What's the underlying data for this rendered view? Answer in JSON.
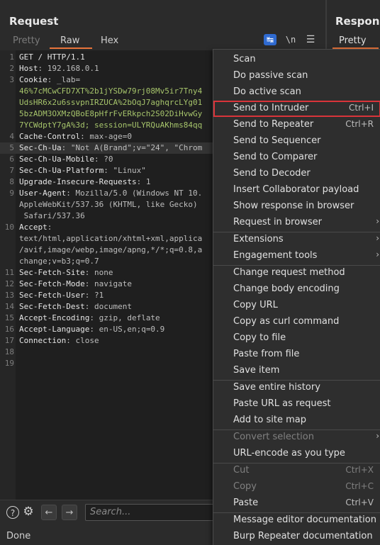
{
  "request_panel": {
    "title": "Request",
    "tabs": [
      {
        "label": "Pretty"
      },
      {
        "label": "Raw"
      },
      {
        "label": "Hex"
      }
    ],
    "toolbar": {
      "newline_label": "\\n"
    }
  },
  "response_panel": {
    "title": "Response",
    "tab": "Pretty"
  },
  "editor": {
    "lines": [
      {
        "n": "1",
        "key": "GET / HTTP/1.1",
        "val": "",
        "cont": ""
      },
      {
        "n": "2",
        "key": "Host",
        "val": ": 192.168.0.1",
        "cont": ""
      },
      {
        "n": "3",
        "key": "Cookie",
        "val": ": _lab=",
        "cont": ""
      },
      {
        "n": "",
        "key": "",
        "val": "",
        "cont": "46%7cMCwCFD7XT%2b1jYSDw79rj08Mv5ir7Tny4"
      },
      {
        "n": "",
        "key": "",
        "val": "",
        "cont": "UdsHR6x2u6ssvpnIRZUCA%2bOqJ7aghqrcLYg01"
      },
      {
        "n": "",
        "key": "",
        "val": "",
        "cont": "5bzADM3OXMzQBoE8pHfrFvERkpch2S02DiHvwGy"
      },
      {
        "n": "",
        "key": "",
        "val": "",
        "cont": "7YCWdptY7gA%3d; session=ULYRQuAKhms84qq"
      },
      {
        "n": "4",
        "key": "Cache-Control",
        "val": ": max-age=0",
        "cont": ""
      },
      {
        "n": "5",
        "key": "Sec-Ch-Ua",
        "val": ": \"Not A(Brand\";v=\"24\", \"Chrom",
        "cont": ""
      },
      {
        "n": "6",
        "key": "Sec-Ch-Ua-Mobile",
        "val": ": ?0",
        "cont": ""
      },
      {
        "n": "7",
        "key": "Sec-Ch-Ua-Platform",
        "val": ": \"Linux\"",
        "cont": ""
      },
      {
        "n": "8",
        "key": "Upgrade-Insecure-Requests",
        "val": ": 1",
        "cont": ""
      },
      {
        "n": "9",
        "key": "User-Agent",
        "val": ": Mozilla/5.0 (Windows NT 10.",
        "cont": ""
      },
      {
        "n": "",
        "key": "",
        "val": "AppleWebKit/537.36 (KHTML, like Gecko)",
        "cont": ""
      },
      {
        "n": "",
        "key": "",
        "val": " Safari/537.36",
        "cont": ""
      },
      {
        "n": "10",
        "key": "Accept",
        "val": ":",
        "cont": ""
      },
      {
        "n": "",
        "key": "",
        "val": "text/html,application/xhtml+xml,applica",
        "cont": ""
      },
      {
        "n": "",
        "key": "",
        "val": "/avif,image/webp,image/apng,*/*;q=0.8,a",
        "cont": ""
      },
      {
        "n": "",
        "key": "",
        "val": "change;v=b3;q=0.7",
        "cont": ""
      },
      {
        "n": "11",
        "key": "Sec-Fetch-Site",
        "val": ": none",
        "cont": ""
      },
      {
        "n": "12",
        "key": "Sec-Fetch-Mode",
        "val": ": navigate",
        "cont": ""
      },
      {
        "n": "13",
        "key": "Sec-Fetch-User",
        "val": ": ?1",
        "cont": ""
      },
      {
        "n": "14",
        "key": "Sec-Fetch-Dest",
        "val": ": document",
        "cont": ""
      },
      {
        "n": "15",
        "key": "Accept-Encoding",
        "val": ": gzip, deflate",
        "cont": ""
      },
      {
        "n": "16",
        "key": "Accept-Language",
        "val": ": en-US,en;q=0.9",
        "cont": ""
      },
      {
        "n": "17",
        "key": "Connection",
        "val": ": close",
        "cont": ""
      },
      {
        "n": "18",
        "key": "",
        "val": "",
        "cont": ""
      },
      {
        "n": "19",
        "key": "",
        "val": "",
        "cont": ""
      }
    ]
  },
  "bottom_bar": {
    "search_placeholder": "Search...",
    "status": "Done"
  },
  "context_menu": {
    "items": [
      {
        "label": "Scan"
      },
      {
        "label": "Do passive scan"
      },
      {
        "label": "Do active scan"
      },
      {
        "label": "Send to Intruder",
        "shortcut": "Ctrl+I",
        "highlighted": true
      },
      {
        "label": "Send to Repeater",
        "shortcut": "Ctrl+R"
      },
      {
        "label": "Send to Sequencer"
      },
      {
        "label": "Send to Comparer"
      },
      {
        "label": "Send to Decoder"
      },
      {
        "label": "Insert Collaborator payload"
      },
      {
        "label": "Show response in browser"
      },
      {
        "label": "Request in browser",
        "submenu": true
      },
      {
        "label": "Extensions",
        "submenu": true
      },
      {
        "label": "Engagement tools",
        "submenu": true
      },
      {
        "label": "Change request method"
      },
      {
        "label": "Change body encoding"
      },
      {
        "label": "Copy URL"
      },
      {
        "label": "Copy as curl command"
      },
      {
        "label": "Copy to file"
      },
      {
        "label": "Paste from file"
      },
      {
        "label": "Save item"
      },
      {
        "label": "Save entire history"
      },
      {
        "label": "Paste URL as request"
      },
      {
        "label": "Add to site map"
      },
      {
        "label": "Convert selection",
        "submenu": true,
        "disabled": true
      },
      {
        "label": "URL-encode as you type"
      },
      {
        "label": "Cut",
        "shortcut": "Ctrl+X",
        "disabled": true
      },
      {
        "label": "Copy",
        "shortcut": "Ctrl+C",
        "disabled": true
      },
      {
        "label": "Paste",
        "shortcut": "Ctrl+V"
      },
      {
        "label": "Message editor documentation"
      },
      {
        "label": "Burp Repeater documentation"
      }
    ]
  },
  "colors": {
    "accent": "#e8743b",
    "highlight_border": "#d9343a",
    "wrap_button": "#2f6ad0",
    "cookie_value": "#a6c46b"
  }
}
